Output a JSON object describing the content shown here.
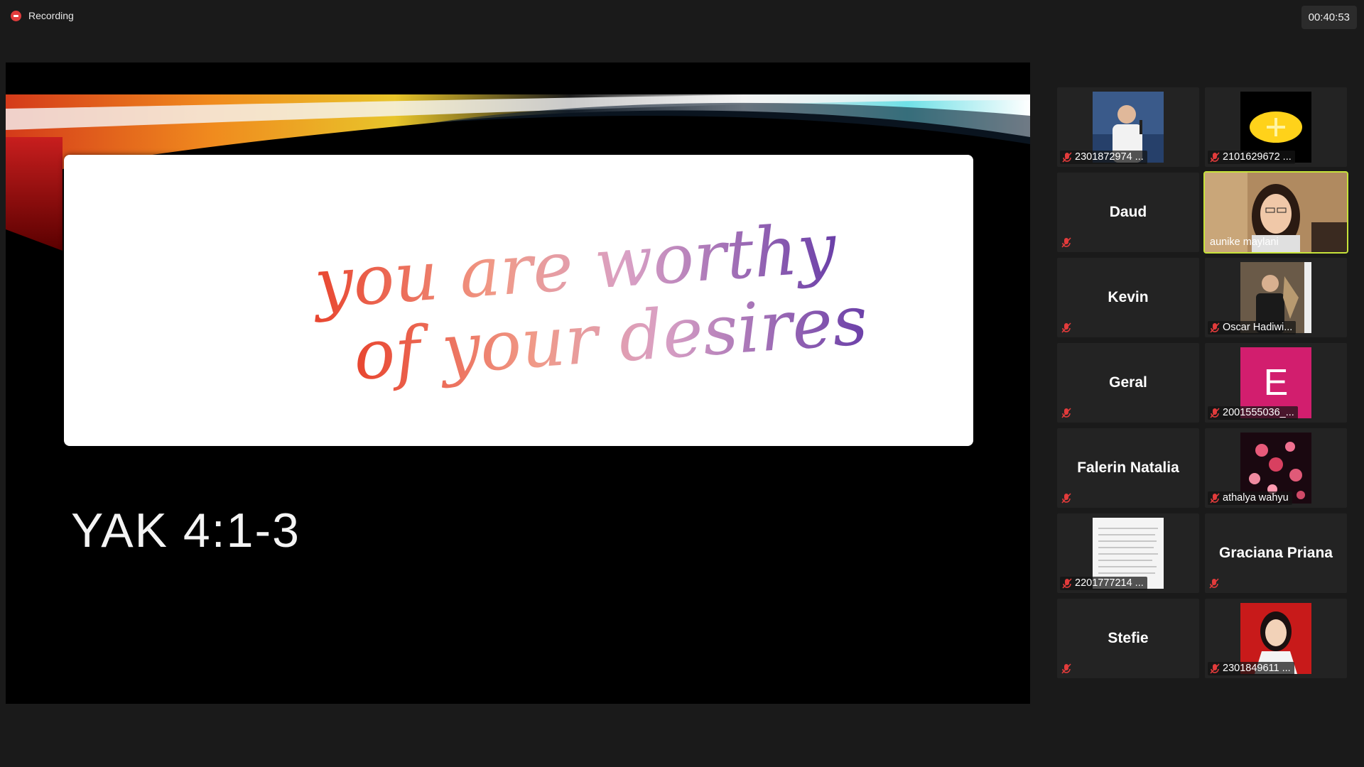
{
  "header": {
    "recording_label": "Recording",
    "timer": "00:40:53"
  },
  "share": {
    "handwriting_line1": "you are worthy",
    "handwriting_line2": "of your desires",
    "verse": "YAK 4:1-3"
  },
  "participants": [
    {
      "name": "2301872974 ...",
      "type": "video",
      "thumb": "man-with-mic"
    },
    {
      "name": "2101629672 ...",
      "type": "video",
      "thumb": "yellow-plus"
    },
    {
      "name": "Daud",
      "type": "name-only"
    },
    {
      "name": "aunike maylani",
      "type": "video",
      "thumb": "woman-speaking",
      "active_speaker": true
    },
    {
      "name": "Kevin",
      "type": "name-only"
    },
    {
      "name": "Oscar Hadiwi...",
      "type": "video",
      "thumb": "man-in-suit"
    },
    {
      "name": "Geral",
      "type": "name-only"
    },
    {
      "name": "2001555036_...",
      "type": "video",
      "thumb": "letter-avatar",
      "avatar_letter": "E",
      "avatar_color": "#d21e6e"
    },
    {
      "name": "Falerin Natalia",
      "type": "name-only"
    },
    {
      "name": "athalya wahyu",
      "type": "video",
      "thumb": "pink-flowers"
    },
    {
      "name": "2201777214 ...",
      "type": "video",
      "thumb": "document"
    },
    {
      "name": "Graciana Priana",
      "type": "name-only"
    },
    {
      "name": "Stefie",
      "type": "name-only"
    },
    {
      "name": "2301849611 ...",
      "type": "video",
      "thumb": "woman-red-bg"
    }
  ],
  "colors": {
    "mute_red": "#e23b3b",
    "active_speaker_border": "#c7e33a",
    "background": "#1a1a1a"
  }
}
